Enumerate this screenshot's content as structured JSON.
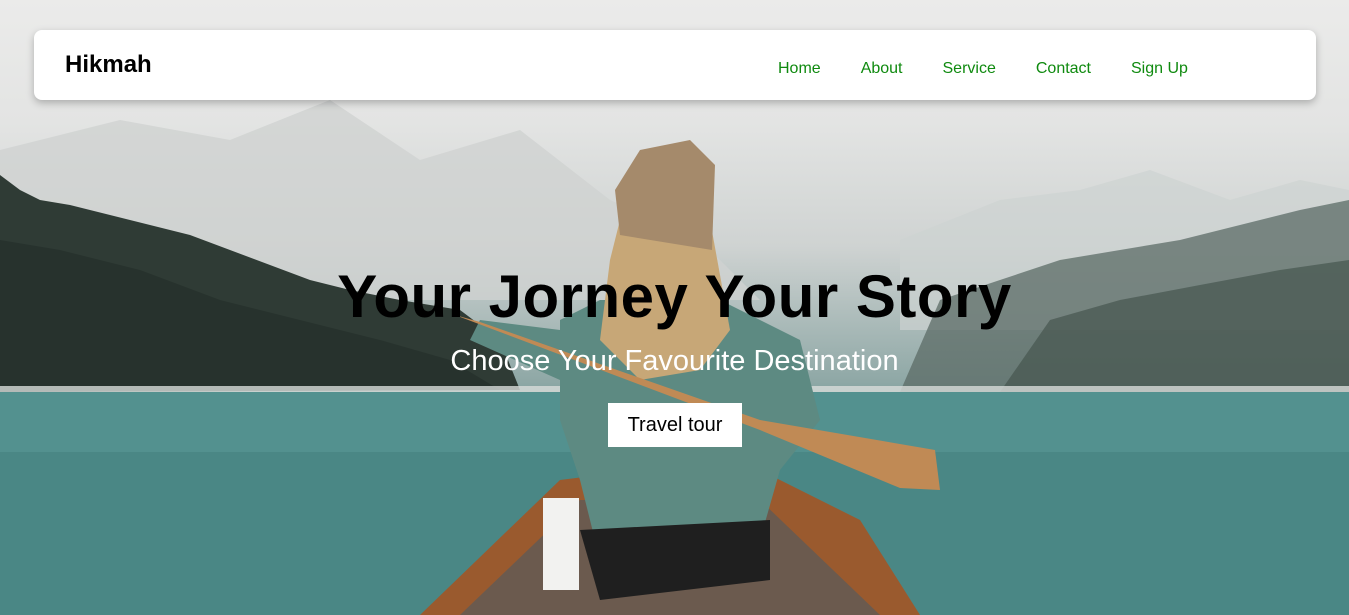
{
  "brand": {
    "name": "Hikmah"
  },
  "nav": {
    "items": [
      {
        "label": "Home"
      },
      {
        "label": "About"
      },
      {
        "label": "Service"
      },
      {
        "label": "Contact"
      },
      {
        "label": "Sign Up"
      }
    ],
    "link_color": "#0f8a0f"
  },
  "hero": {
    "title": "Your Jorney Your Story",
    "subtitle": "Choose Your Favourite Destination",
    "button_label": "Travel tour",
    "image_description_colors": {
      "sky": "#e6e6e5",
      "lake": "#3f7c7b",
      "forest": "#2f3b35"
    }
  }
}
